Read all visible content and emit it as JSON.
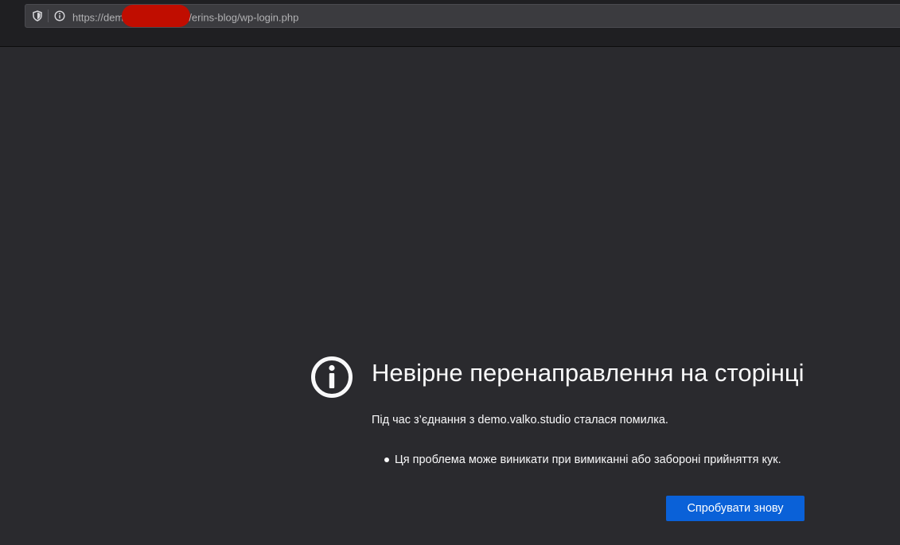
{
  "urlbar": {
    "url_prefix": "https://dem",
    "url_suffix": "/erins-blog/wp-login.php"
  },
  "error": {
    "title": "Невірне перенаправлення на сторінці",
    "description": "Під час з’єднання з demo.valko.studio сталася помилка.",
    "bullets": [
      "Ця проблема може виникати при вимиканні або забороні прийняття кук."
    ],
    "retry_label": "Спробувати знову"
  },
  "colors": {
    "background": "#2a2a2e",
    "toolbar": "#1f1f22",
    "urlbar": "#3b3b3f",
    "text": "#f9f9fa",
    "button": "#0a61d8",
    "redaction": "#c00d00"
  },
  "icons": {
    "tracking_protection": "shield-icon",
    "site_info": "info-icon",
    "error": "info-circle-icon"
  }
}
